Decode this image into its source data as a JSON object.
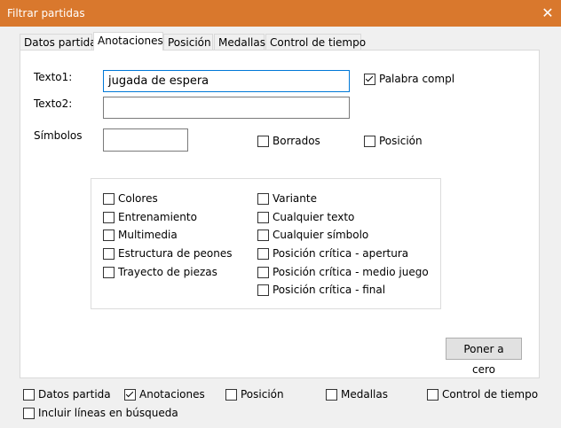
{
  "window": {
    "title": "Filtrar partidas",
    "close_glyph": "✕"
  },
  "tabs": [
    {
      "label": "Datos partida"
    },
    {
      "label": "Anotaciones"
    },
    {
      "label": "Posición"
    },
    {
      "label": "Medallas"
    },
    {
      "label": "Control de tiempo"
    }
  ],
  "active_tab": "Anotaciones",
  "form": {
    "texto1_label": "Texto1:",
    "texto1_value": "jugada de espera",
    "texto2_label": "Texto2:",
    "texto2_value": "",
    "simbolos_label": "Símbolos",
    "simbolos_value": "",
    "palabra_completa": {
      "label": "Palabra complet",
      "checked": true
    },
    "borrados": {
      "label": "Borrados",
      "checked": false
    },
    "posicion": {
      "label": "Posición",
      "checked": false
    }
  },
  "annotations_group": {
    "left": [
      {
        "label": "Colores",
        "checked": false
      },
      {
        "label": "Entrenamiento",
        "checked": false
      },
      {
        "label": "Multimedia",
        "checked": false
      },
      {
        "label": "Estructura de peones",
        "checked": false
      },
      {
        "label": "Trayecto de piezas",
        "checked": false
      }
    ],
    "right": [
      {
        "label": "Variante",
        "checked": false
      },
      {
        "label": "Cualquier texto",
        "checked": false
      },
      {
        "label": "Cualquier símbolo",
        "checked": false
      },
      {
        "label": "Posición crítica - apertura",
        "checked": false
      },
      {
        "label": "Posición crítica - medio juego",
        "checked": false
      },
      {
        "label": "Posición crítica - final",
        "checked": false
      }
    ]
  },
  "reset_button": {
    "label": "Poner a cero"
  },
  "footer": {
    "row1": [
      {
        "label": "Datos partida",
        "checked": false
      },
      {
        "label": "Anotaciones",
        "checked": true
      },
      {
        "label": "Posición",
        "checked": false
      },
      {
        "label": "Medallas",
        "checked": false
      },
      {
        "label": "Control de tiempo",
        "checked": false
      }
    ],
    "row2": [
      {
        "label": "Incluir líneas en búsqueda",
        "checked": false
      }
    ]
  },
  "colors": {
    "titlebar": "#d9782d",
    "focus_border": "#0078d7"
  }
}
